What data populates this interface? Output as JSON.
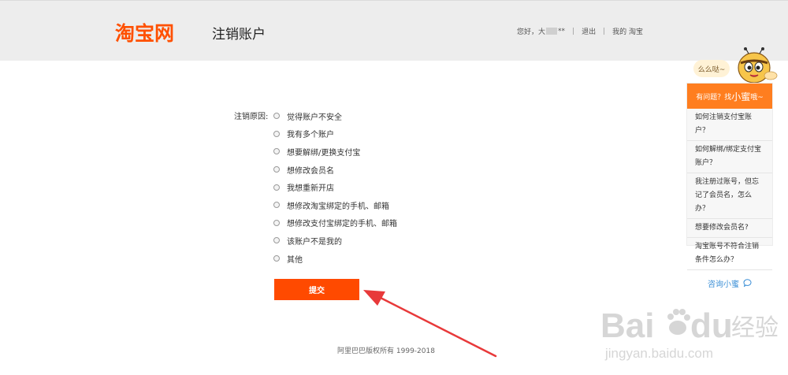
{
  "header": {
    "logo_text": "淘宝网",
    "page_title": "注销账户",
    "greeting_prefix": "您好，大",
    "greeting_suffix": "**",
    "logout_label": "退出",
    "my_taobao_label": "我的 淘宝",
    "separator": "|"
  },
  "form": {
    "reason_label": "注销原因:",
    "options": [
      "觉得账户不安全",
      "我有多个账户",
      "想要解绑/更换支付宝",
      "想修改会员名",
      "我想重新开店",
      "想修改淘宝绑定的手机、邮箱",
      "想修改支付宝绑定的手机、邮箱",
      "该账户不是我的",
      "其他"
    ],
    "submit_label": "提交"
  },
  "footer": {
    "copyright": "阿里巴巴版权所有 1999-2018"
  },
  "helper": {
    "bubble_text": "么么哒~",
    "title_prefix": "有问题？找",
    "title_big": "小蜜",
    "title_suffix": "哦~",
    "questions": [
      "如何注销支付宝账户？",
      "如何解绑/绑定支付宝账户？",
      "我注册过账号，但忘记了会员名，怎么办？",
      "想要修改会员名?",
      "淘宝账号不符合注销条件怎么办？"
    ],
    "consult_label": "咨询小蜜"
  },
  "watermark": {
    "brand": "Bai",
    "brand_tail": "du",
    "cn_text": "经验",
    "url": "jingyan.baidu.com"
  },
  "colors": {
    "brand_orange": "#ff5000",
    "submit_orange": "#ff4a00",
    "helper_orange": "#ff7e1f",
    "link_blue": "#3b8fd6",
    "annotation_red": "#e8393a"
  }
}
